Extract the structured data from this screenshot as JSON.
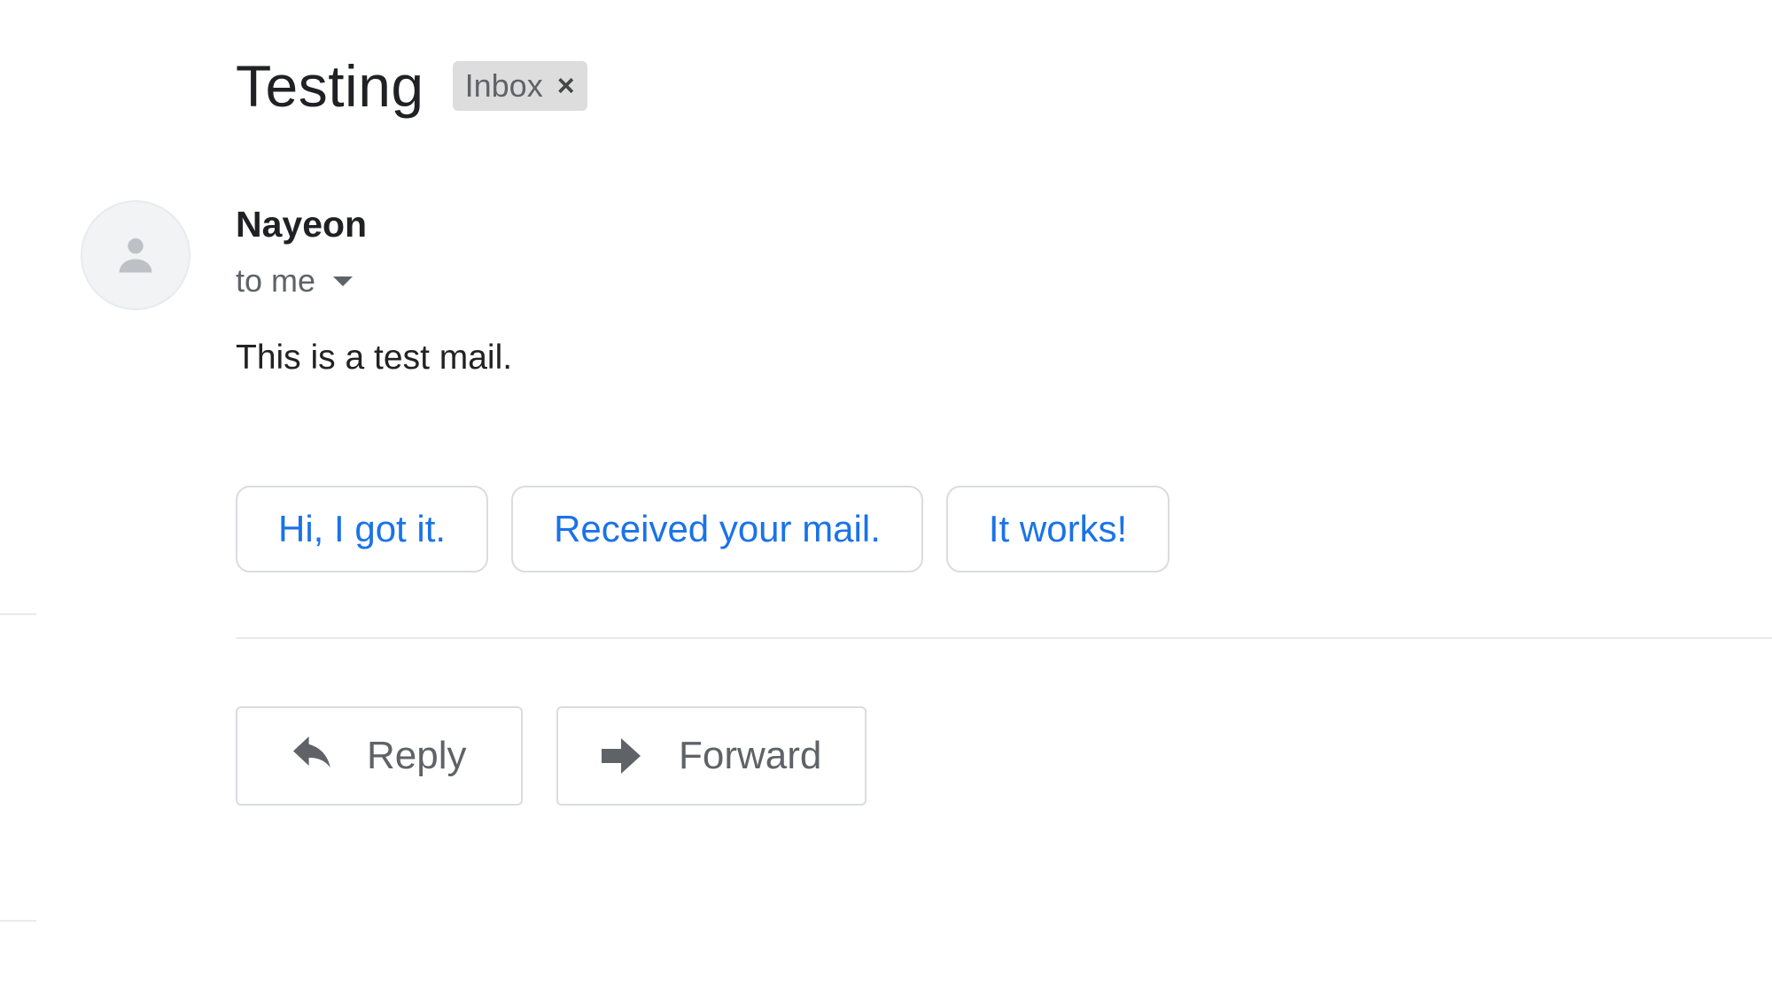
{
  "thread": {
    "subject": "Testing",
    "label": "Inbox",
    "label_close_icon": "close-icon"
  },
  "message": {
    "avatar_icon": "person-icon",
    "sender": "Nayeon",
    "recipients": "to me",
    "recipients_toggle_icon": "caret-down-icon",
    "body": "This is a test mail."
  },
  "smart_replies": [
    {
      "label": "Hi, I got it."
    },
    {
      "label": "Received your mail."
    },
    {
      "label": "It works!"
    }
  ],
  "actions": {
    "reply_label": "Reply",
    "reply_icon": "reply-icon",
    "forward_label": "Forward",
    "forward_icon": "forward-icon"
  },
  "colors": {
    "link_blue": "#1a73e8",
    "text_primary": "#202124",
    "text_secondary": "#5f6368",
    "chip_background": "#dddddd",
    "border": "#dadce0"
  }
}
